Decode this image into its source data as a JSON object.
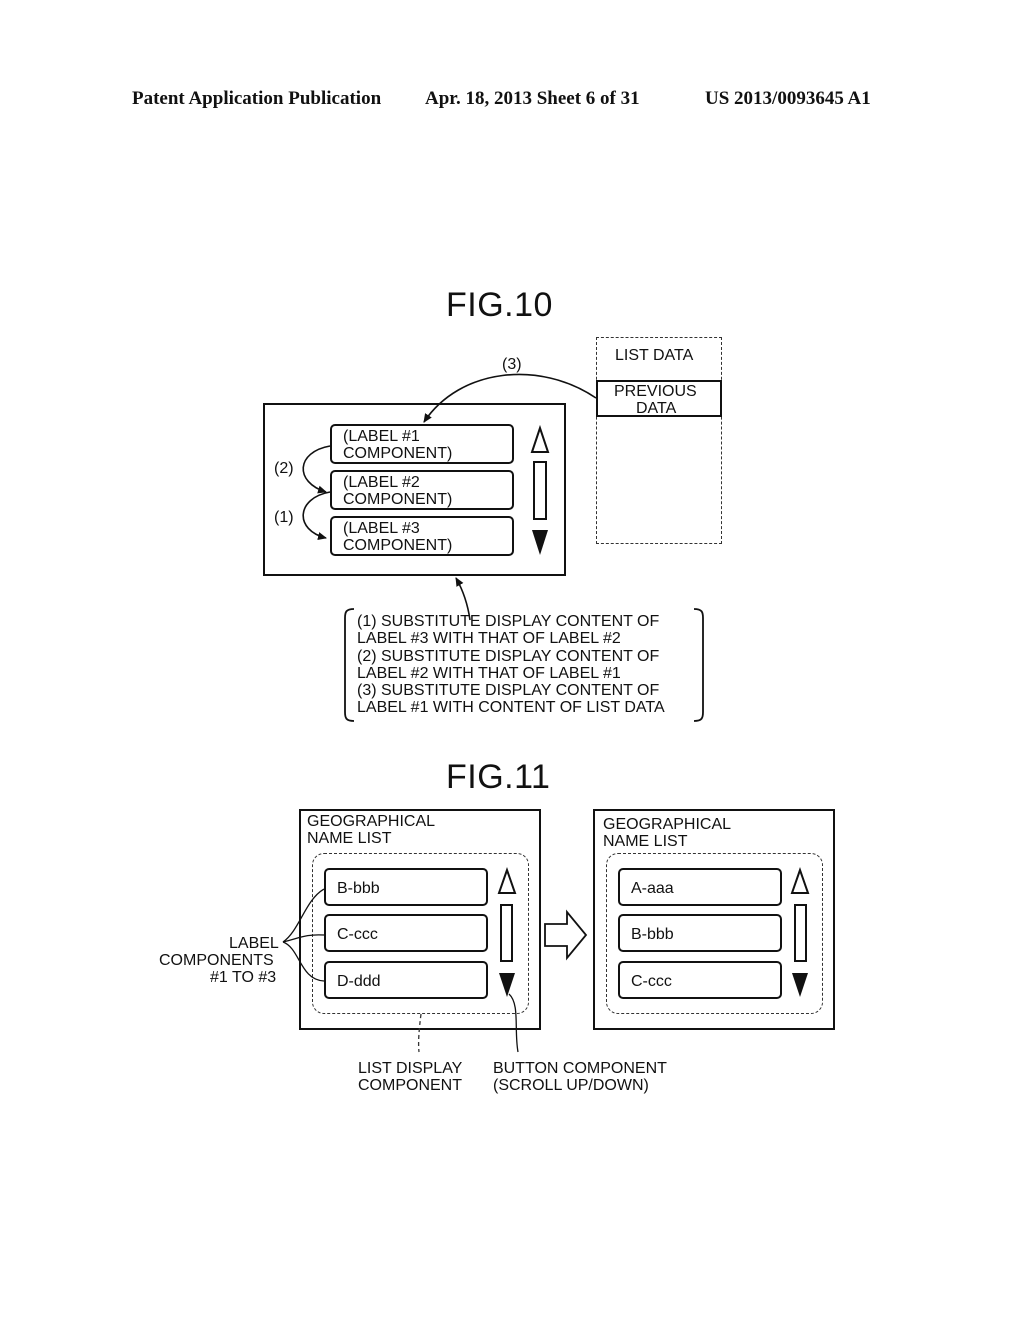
{
  "header": {
    "publication": "Patent Application Publication",
    "date_sheet": "Apr. 18, 2013  Sheet 6 of 31",
    "patent_number": "US 2013/0093645 A1"
  },
  "fig10": {
    "title": "FIG.10",
    "labels": [
      {
        "line1": "(LABEL #1",
        "line2": "COMPONENT)"
      },
      {
        "line1": "(LABEL #2",
        "line2": "COMPONENT)"
      },
      {
        "line1": "(LABEL #3",
        "line2": "COMPONENT)"
      }
    ],
    "step_markers": {
      "one": "(1)",
      "two": "(2)",
      "three": "(3)"
    },
    "list_data": {
      "title": "LIST DATA",
      "previous_line1": "PREVIOUS",
      "previous_line2": "DATA"
    },
    "note_lines": [
      "(1) SUBSTITUTE DISPLAY CONTENT OF",
      "LABEL #3 WITH THAT OF LABEL #2",
      "(2) SUBSTITUTE DISPLAY CONTENT OF",
      "LABEL #2 WITH THAT OF LABEL #1",
      "(3) SUBSTITUTE DISPLAY CONTENT OF",
      "LABEL #1 WITH CONTENT OF LIST DATA"
    ]
  },
  "fig11": {
    "title": "FIG.11",
    "before": {
      "title_line1": "GEOGRAPHICAL",
      "title_line2": "NAME LIST",
      "items": [
        "B-bbb",
        "C-ccc",
        "D-ddd"
      ]
    },
    "after": {
      "title_line1": "GEOGRAPHICAL",
      "title_line2": "NAME LIST",
      "items": [
        "A-aaa",
        "B-bbb",
        "C-ccc"
      ]
    },
    "callouts": {
      "label_components": [
        "LABEL",
        "COMPONENTS",
        "#1 TO #3"
      ],
      "list_display": [
        "LIST DISPLAY",
        "COMPONENT"
      ],
      "button_component": [
        "BUTTON COMPONENT",
        "(SCROLL UP/DOWN)"
      ]
    }
  },
  "icons": {
    "scroll_up": "up-triangle-outline",
    "scroll_down": "down-triangle-filled",
    "transition_arrow": "right-block-arrow"
  }
}
